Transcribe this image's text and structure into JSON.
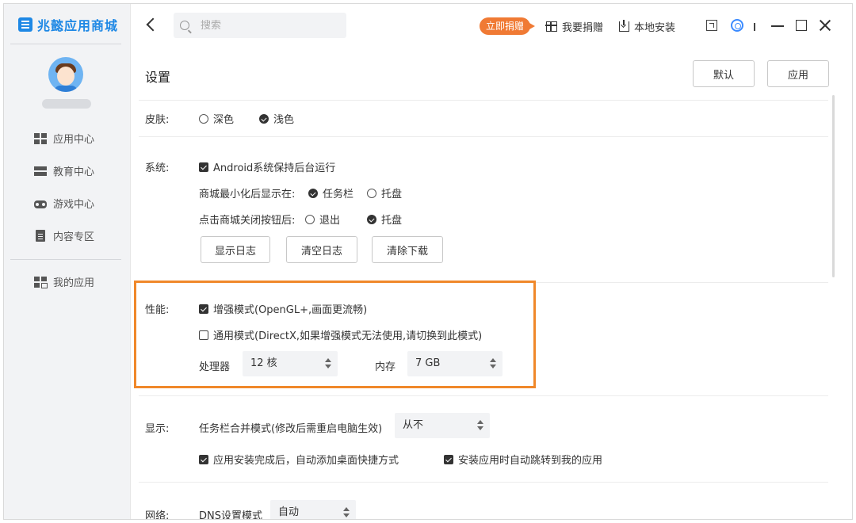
{
  "app": {
    "name": "兆懿应用商城"
  },
  "sidebar": {
    "items": [
      {
        "label": "应用中心",
        "icon": "grid-icon"
      },
      {
        "label": "教育中心",
        "icon": "bars-icon"
      },
      {
        "label": "游戏中心",
        "icon": "gamepad-icon"
      },
      {
        "label": "内容专区",
        "icon": "document-icon"
      },
      {
        "label": "我的应用",
        "icon": "apps-icon"
      }
    ]
  },
  "topbar": {
    "search_placeholder": "搜索",
    "donate_now": "立即捐赠",
    "want_donate": "我要捐赠",
    "local_install": "本地安装"
  },
  "header": {
    "title": "设置",
    "default_btn": "默认",
    "apply_btn": "应用"
  },
  "skin": {
    "label": "皮肤:",
    "options": [
      {
        "label": "深色",
        "selected": false
      },
      {
        "label": "浅色",
        "selected": true
      }
    ]
  },
  "system": {
    "label": "系统:",
    "android_bg": {
      "label": "Android系统保持后台运行",
      "checked": true
    },
    "minimize_label": "商城最小化后显示在:",
    "minimize_options": [
      {
        "label": "任务栏",
        "selected": true
      },
      {
        "label": "托盘",
        "selected": false
      }
    ],
    "close_label": "点击商城关闭按钮后:",
    "close_options": [
      {
        "label": "退出",
        "selected": false
      },
      {
        "label": "托盘",
        "selected": true
      }
    ],
    "buttons": [
      "显示日志",
      "清空日志",
      "清除下载"
    ]
  },
  "performance": {
    "label": "性能:",
    "enhanced": {
      "label": "增强模式(OpenGL+,画面更流畅)",
      "checked": true
    },
    "general": {
      "label": "通用模式(DirectX,如果增强模式无法使用,请切换到此模式)",
      "checked": false
    },
    "cpu_label": "处理器",
    "cpu_value": "12 核",
    "memory_label": "内存",
    "memory_value": "7 GB"
  },
  "display": {
    "label": "显示:",
    "merge_label": "任务栏合并模式(修改后需重启电脑生效)",
    "merge_value": "从不",
    "shortcut": {
      "label": "应用安装完成后，自动添加桌面快捷方式",
      "checked": true
    },
    "jump": {
      "label": "安装应用时自动跳转到我的应用",
      "checked": true
    }
  },
  "network": {
    "label": "网络:",
    "dns_label": "DNS设置模式",
    "dns_value": "自动"
  },
  "colors": {
    "accent": "#1e88e5",
    "donate": "#f07a34",
    "highlight": "#f0882a"
  }
}
